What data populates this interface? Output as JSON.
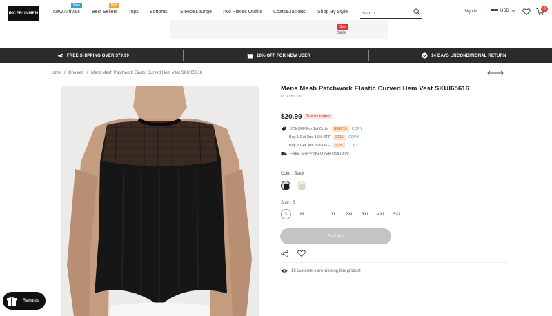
{
  "header": {
    "logo": "INCERUNMEN",
    "nav": [
      {
        "label": "New Arrivals",
        "badge": "New",
        "badge_color": "#2ba7d8"
      },
      {
        "label": "Best Sellers",
        "badge": "Hot",
        "badge_color": "#f5a623"
      },
      {
        "label": "Tops"
      },
      {
        "label": "Bottoms"
      },
      {
        "label": "Sleep&Lounge"
      },
      {
        "label": "Two Pieces Outfits"
      },
      {
        "label": "Coats&Jackets"
      },
      {
        "label": "Shop By Style"
      }
    ],
    "search_placeholder": "Search",
    "signin": "Sign In",
    "currency": "USD",
    "cart_count": "0"
  },
  "promo": {
    "sale_tag": "Sale",
    "sale_label": "Sale"
  },
  "bar": {
    "shipping": "FREE SHIPPING OVER $79.99",
    "new_user": "10% OFF FOR NEW USER",
    "returns": "14 DAYS UNCONDITIONAL RETURN"
  },
  "breadcrumb": [
    "Home",
    "/",
    "Onesies",
    "/",
    "Mens Mesh Patchwork Elastic Curved Hem Vest SKUI65616"
  ],
  "product": {
    "title": "Mens Mesh Patchwork Elastic Curved Hem Vest SKUI65616",
    "sku": "POA9B0190",
    "price": "$20.99",
    "tax": "Tax Included",
    "promos": [
      {
        "text": "10% OFF For 1st Order",
        "code": "NEW10",
        "copy": "COPY"
      },
      {
        "text": "Buy 1 Get 2nd 15% OFF",
        "code": "IC15",
        "copy": "COPY"
      },
      {
        "text": "Buy 2 Get 3rd 25% OFF",
        "code": "IC25",
        "copy": "COPY"
      }
    ],
    "free_shipping": "FREE SHIPPING OVER US$79.99",
    "color_label": "Color : Black",
    "colors": [
      "Black",
      "Beige"
    ],
    "size_label": "Size : S",
    "sizes": [
      "S",
      "M",
      "L",
      "XL",
      "2XL",
      "3XL",
      "4XL",
      "5XL"
    ],
    "sold_out": "Sold Out",
    "viewing": "18 customers are viewing this product"
  },
  "rewards": "Rewards",
  "colors": {
    "bar_bg": "#2b2b2b",
    "sold_out_bg": "#c4c4c4",
    "tax_red": "#c0392b",
    "cart_badge": "#e0403a"
  }
}
